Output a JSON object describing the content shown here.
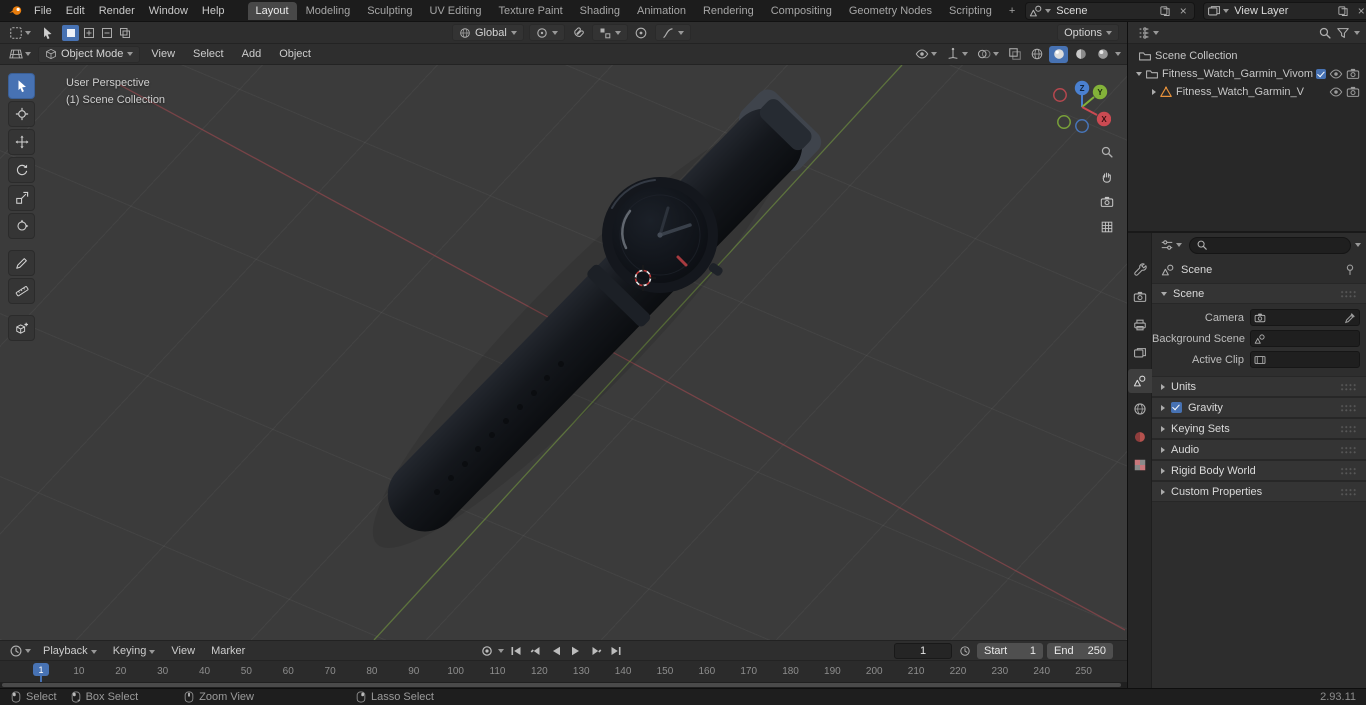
{
  "colors": {
    "accent_blue": "#4772b3",
    "axis_x": "#cb4a52",
    "axis_y": "#83b239",
    "axis_z": "#4a80d0",
    "mesh_orange": "#e8933c"
  },
  "icons": {
    "close": "×",
    "add_workspace": "+"
  },
  "topbar": {
    "menus": [
      "File",
      "Edit",
      "Render",
      "Window",
      "Help"
    ],
    "workspaces": [
      "Layout",
      "Modeling",
      "Sculpting",
      "UV Editing",
      "Texture Paint",
      "Shading",
      "Animation",
      "Rendering",
      "Compositing",
      "Geometry Nodes",
      "Scripting"
    ],
    "active_workspace": "Layout",
    "scene_field_value": "Scene",
    "view_layer_field_value": "View Layer"
  },
  "tool_settings": {
    "orientation_value": "Global",
    "options_label": "Options"
  },
  "viewport": {
    "header": {
      "mode_value": "Object Mode",
      "menus": [
        "View",
        "Select",
        "Add",
        "Object"
      ]
    },
    "overlay_line1": "User Perspective",
    "overlay_line2": "(1) Scene Collection",
    "gizmo": {
      "x": "X",
      "y": "Y",
      "z": "Z"
    }
  },
  "outliner": {
    "root_label": "Scene Collection",
    "items": [
      {
        "label": "Fitness_Watch_Garmin_Vivom"
      },
      {
        "label": "Fitness_Watch_Garmin_V"
      }
    ]
  },
  "properties": {
    "breadcrumb": "Scene",
    "scene_panel_title": "Scene",
    "fields": [
      {
        "label": "Camera"
      },
      {
        "label": "Background Scene"
      },
      {
        "label": "Active Clip"
      }
    ],
    "collapsed_panels": [
      "Units",
      "Gravity",
      "Keying Sets",
      "Audio",
      "Rigid Body World",
      "Custom Properties"
    ]
  },
  "timeline": {
    "menus": [
      "Playback",
      "Keying",
      "View",
      "Marker"
    ],
    "current_frame": "1",
    "playhead_label": "1",
    "start_label": "Start",
    "start_value": "1",
    "end_label": "End",
    "end_value": "250",
    "ticks": [
      "10",
      "20",
      "30",
      "40",
      "50",
      "60",
      "70",
      "80",
      "90",
      "100",
      "110",
      "120",
      "130",
      "140",
      "150",
      "160",
      "170",
      "180",
      "190",
      "200",
      "210",
      "220",
      "230",
      "240",
      "250"
    ]
  },
  "statusbar": {
    "hints": [
      "Select",
      "Box Select",
      "Zoom View",
      "Lasso Select"
    ],
    "version": "2.93.11"
  }
}
